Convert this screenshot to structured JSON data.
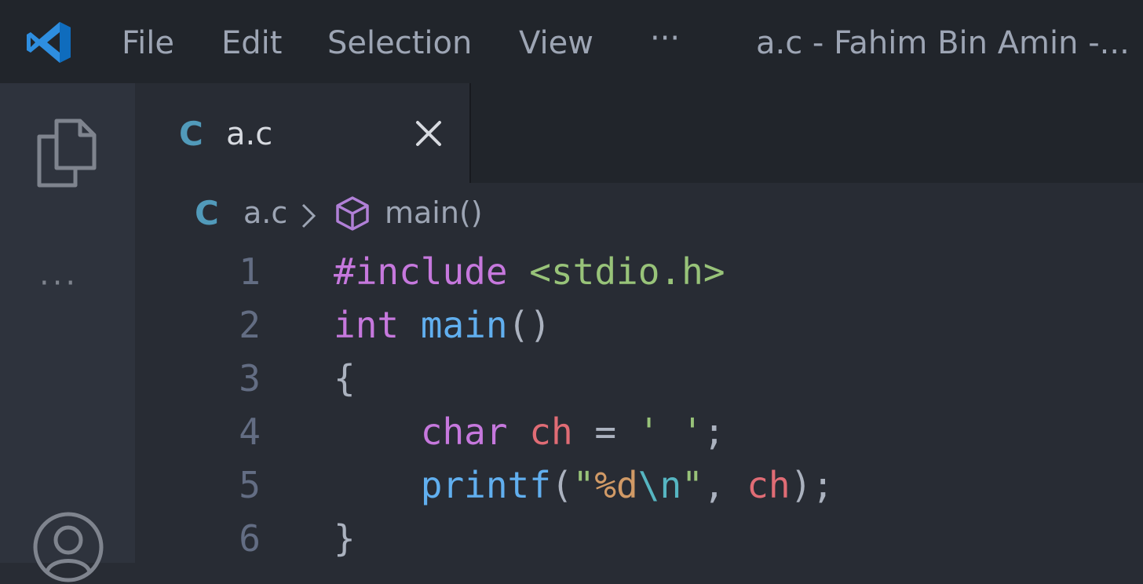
{
  "titlebar": {
    "menu": [
      "File",
      "Edit",
      "Selection",
      "View"
    ],
    "more": "···",
    "window_title": "a.c - Fahim Bin Amin -..."
  },
  "tab": {
    "icon_letter": "C",
    "label": "a.c"
  },
  "breadcrumb": {
    "icon_letter": "C",
    "file": "a.c",
    "symbol": "main()"
  },
  "activitybar": {
    "more": "···"
  },
  "editor": {
    "lines": [
      {
        "number": "1",
        "tokens": [
          {
            "t": "#include",
            "c": "kw"
          },
          {
            "t": " ",
            "c": "punc"
          },
          {
            "t": "<stdio.h>",
            "c": "str"
          }
        ]
      },
      {
        "number": "2",
        "tokens": [
          {
            "t": "int",
            "c": "kw"
          },
          {
            "t": " ",
            "c": "punc"
          },
          {
            "t": "main",
            "c": "fn"
          },
          {
            "t": "()",
            "c": "punc"
          }
        ]
      },
      {
        "number": "3",
        "tokens": [
          {
            "t": "{",
            "c": "punc"
          }
        ]
      },
      {
        "number": "4",
        "tokens": [
          {
            "t": "    ",
            "c": "punc"
          },
          {
            "t": "char",
            "c": "kw"
          },
          {
            "t": " ",
            "c": "punc"
          },
          {
            "t": "ch",
            "c": "var"
          },
          {
            "t": " = ",
            "c": "punc"
          },
          {
            "t": "' '",
            "c": "str"
          },
          {
            "t": ";",
            "c": "punc"
          }
        ]
      },
      {
        "number": "5",
        "tokens": [
          {
            "t": "    ",
            "c": "punc"
          },
          {
            "t": "printf",
            "c": "fn"
          },
          {
            "t": "(",
            "c": "punc"
          },
          {
            "t": "\"",
            "c": "str"
          },
          {
            "t": "%d",
            "c": "fmt"
          },
          {
            "t": "\\n",
            "c": "esc"
          },
          {
            "t": "\"",
            "c": "str"
          },
          {
            "t": ", ",
            "c": "punc"
          },
          {
            "t": "ch",
            "c": "var"
          },
          {
            "t": ");",
            "c": "punc"
          }
        ]
      },
      {
        "number": "6",
        "tokens": [
          {
            "t": "}",
            "c": "punc"
          }
        ]
      }
    ]
  },
  "colors": {
    "keyword": "#c678dd",
    "string": "#98c379",
    "function": "#61afef",
    "variable": "#e06c75",
    "format": "#d19a66",
    "escape": "#56b6c2",
    "c_icon": "#519aba",
    "symbol_icon": "#b180d7"
  },
  "icons": [
    "vscode-logo-icon",
    "files-icon",
    "ellipsis-icon",
    "account-icon",
    "close-icon",
    "chevron-right-icon",
    "symbol-method-icon"
  ]
}
